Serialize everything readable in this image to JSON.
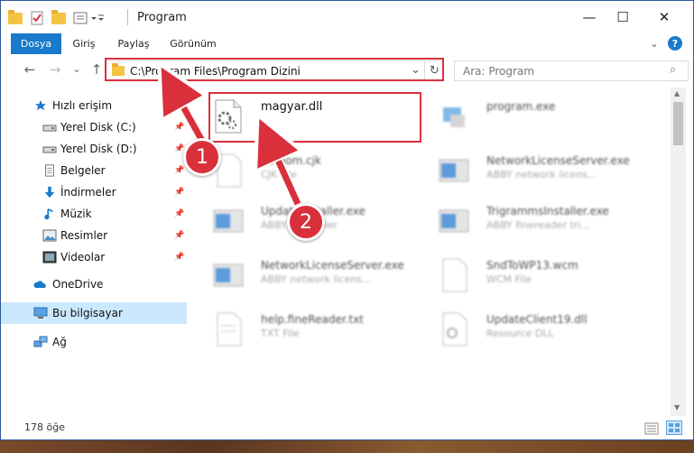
{
  "window": {
    "title": "Program"
  },
  "window_controls": {
    "minimize": "—",
    "maximize": "☐",
    "close": "✕"
  },
  "ribbon": {
    "tabs": [
      "Dosya",
      "Giriş",
      "Paylaş",
      "Görünüm"
    ],
    "help": "?",
    "expand": "⌄"
  },
  "nav": {
    "back": "←",
    "forward": "→",
    "recent": "⌄",
    "up": "↑"
  },
  "address": {
    "path": "C:\\Program Files\\Program Dizini",
    "dropdown": "⌄",
    "refresh": "↻"
  },
  "search": {
    "placeholder": "Ara: Program",
    "icon": "⌕"
  },
  "sidebar": {
    "items": [
      {
        "label": "Hızlı erişim",
        "icon": "star-icon",
        "pinned": false
      },
      {
        "label": "Yerel Disk (C:)",
        "icon": "drive-icon",
        "pinned": true
      },
      {
        "label": "Yerel Disk (D:)",
        "icon": "drive-icon",
        "pinned": true
      },
      {
        "label": "Belgeler",
        "icon": "documents-icon",
        "pinned": true
      },
      {
        "label": "İndirmeler",
        "icon": "download-icon",
        "pinned": true
      },
      {
        "label": "Müzik",
        "icon": "music-icon",
        "pinned": true
      },
      {
        "label": "Resimler",
        "icon": "pictures-icon",
        "pinned": true
      },
      {
        "label": "Videolar",
        "icon": "videos-icon",
        "pinned": true
      },
      {
        "label": "OneDrive",
        "icon": "cloud-icon",
        "pinned": false
      },
      {
        "label": "Bu bilgisayar",
        "icon": "computer-icon",
        "pinned": false
      },
      {
        "label": "Ağ",
        "icon": "network-icon",
        "pinned": false
      }
    ],
    "pin_glyph": "📌"
  },
  "files": [
    {
      "name": "magyar.dll",
      "desc": ""
    },
    {
      "name": "program.exe",
      "desc": ""
    },
    {
      "name": "fioraom.cjk",
      "desc": "CJK File"
    },
    {
      "name": "NetworkLicenseServer.exe",
      "desc": "ABBY network licens..."
    },
    {
      "name": "UpdateInstaller.exe",
      "desc": "ABBY... installer"
    },
    {
      "name": "TrigrammsInstaller.exe",
      "desc": "ABBY finereader tri..."
    },
    {
      "name": "NetworkLicenseServer.exe",
      "desc": "ABBY network licens..."
    },
    {
      "name": "SndToWP13.wcm",
      "desc": "WCM File"
    },
    {
      "name": "help.fineReader.txt",
      "desc": "TXT File"
    },
    {
      "name": "UpdateClient19.dll",
      "desc": "Resource DLL"
    }
  ],
  "status": {
    "count": "178 öğe"
  },
  "callouts": {
    "step1": "1",
    "step2": "2"
  },
  "colors": {
    "accent": "#1979ca",
    "highlight": "#d9303b",
    "selected": "#cce8ff"
  }
}
